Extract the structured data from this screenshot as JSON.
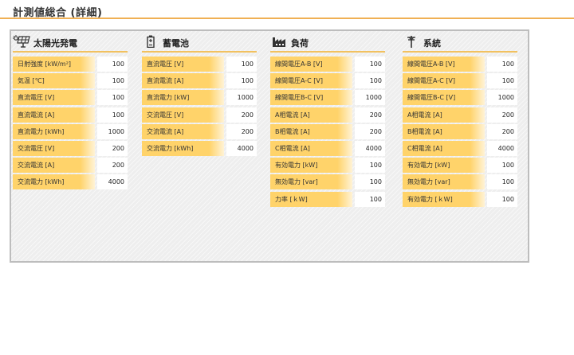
{
  "page": {
    "title": "計測値総合 (詳細)"
  },
  "sections": [
    {
      "title": "太陽光発電",
      "icon": "solar-panel-icon",
      "rows": [
        {
          "label": "日射強度 [kW/m²]",
          "value": "100"
        },
        {
          "label": "気温 [℃]",
          "value": "100"
        },
        {
          "label": "直流電圧 [V]",
          "value": "100"
        },
        {
          "label": "直流電流 [A]",
          "value": "100"
        },
        {
          "label": "直流電力 [kWh]",
          "value": "1000"
        },
        {
          "label": "交流電圧 [V]",
          "value": "200"
        },
        {
          "label": "交流電流 [A]",
          "value": "200"
        },
        {
          "label": "交流電力 [kWh]",
          "value": "4000"
        }
      ]
    },
    {
      "title": "蓄電池",
      "icon": "battery-icon",
      "rows": [
        {
          "label": "直流電圧 [V]",
          "value": "100"
        },
        {
          "label": "直流電流 [A]",
          "value": "100"
        },
        {
          "label": "直流電力 [kW]",
          "value": "1000"
        },
        {
          "label": "交流電圧 [V]",
          "value": "200"
        },
        {
          "label": "交流電流 [A]",
          "value": "200"
        },
        {
          "label": "交流電力 [kWh]",
          "value": "4000"
        }
      ]
    },
    {
      "title": "負荷",
      "icon": "factory-icon",
      "rows": [
        {
          "label": "線間電圧A-B [V]",
          "value": "100"
        },
        {
          "label": "線間電圧A-C [V]",
          "value": "100"
        },
        {
          "label": "線間電圧B-C [V]",
          "value": "1000"
        },
        {
          "label": "A相電流 [A]",
          "value": "200"
        },
        {
          "label": "B相電流 [A]",
          "value": "200"
        },
        {
          "label": "C相電流 [A]",
          "value": "4000"
        },
        {
          "label": "有効電力 [kW]",
          "value": "100"
        },
        {
          "label": "無効電力 [var]",
          "value": "100"
        },
        {
          "label": "力率 [ｋW]",
          "value": "100"
        }
      ]
    },
    {
      "title": "系統",
      "icon": "utility-pole-icon",
      "rows": [
        {
          "label": "線間電圧A-B [V]",
          "value": "100"
        },
        {
          "label": "線間電圧A-C [V]",
          "value": "100"
        },
        {
          "label": "線間電圧B-C [V]",
          "value": "1000"
        },
        {
          "label": "A相電流 [A]",
          "value": "200"
        },
        {
          "label": "B相電流 [A]",
          "value": "200"
        },
        {
          "label": "C相電流 [A]",
          "value": "4000"
        },
        {
          "label": "有効電力 [kW]",
          "value": "100"
        },
        {
          "label": "無効電力 [var]",
          "value": "100"
        },
        {
          "label": "有効電力 [ｋW]",
          "value": "100"
        }
      ]
    }
  ]
}
